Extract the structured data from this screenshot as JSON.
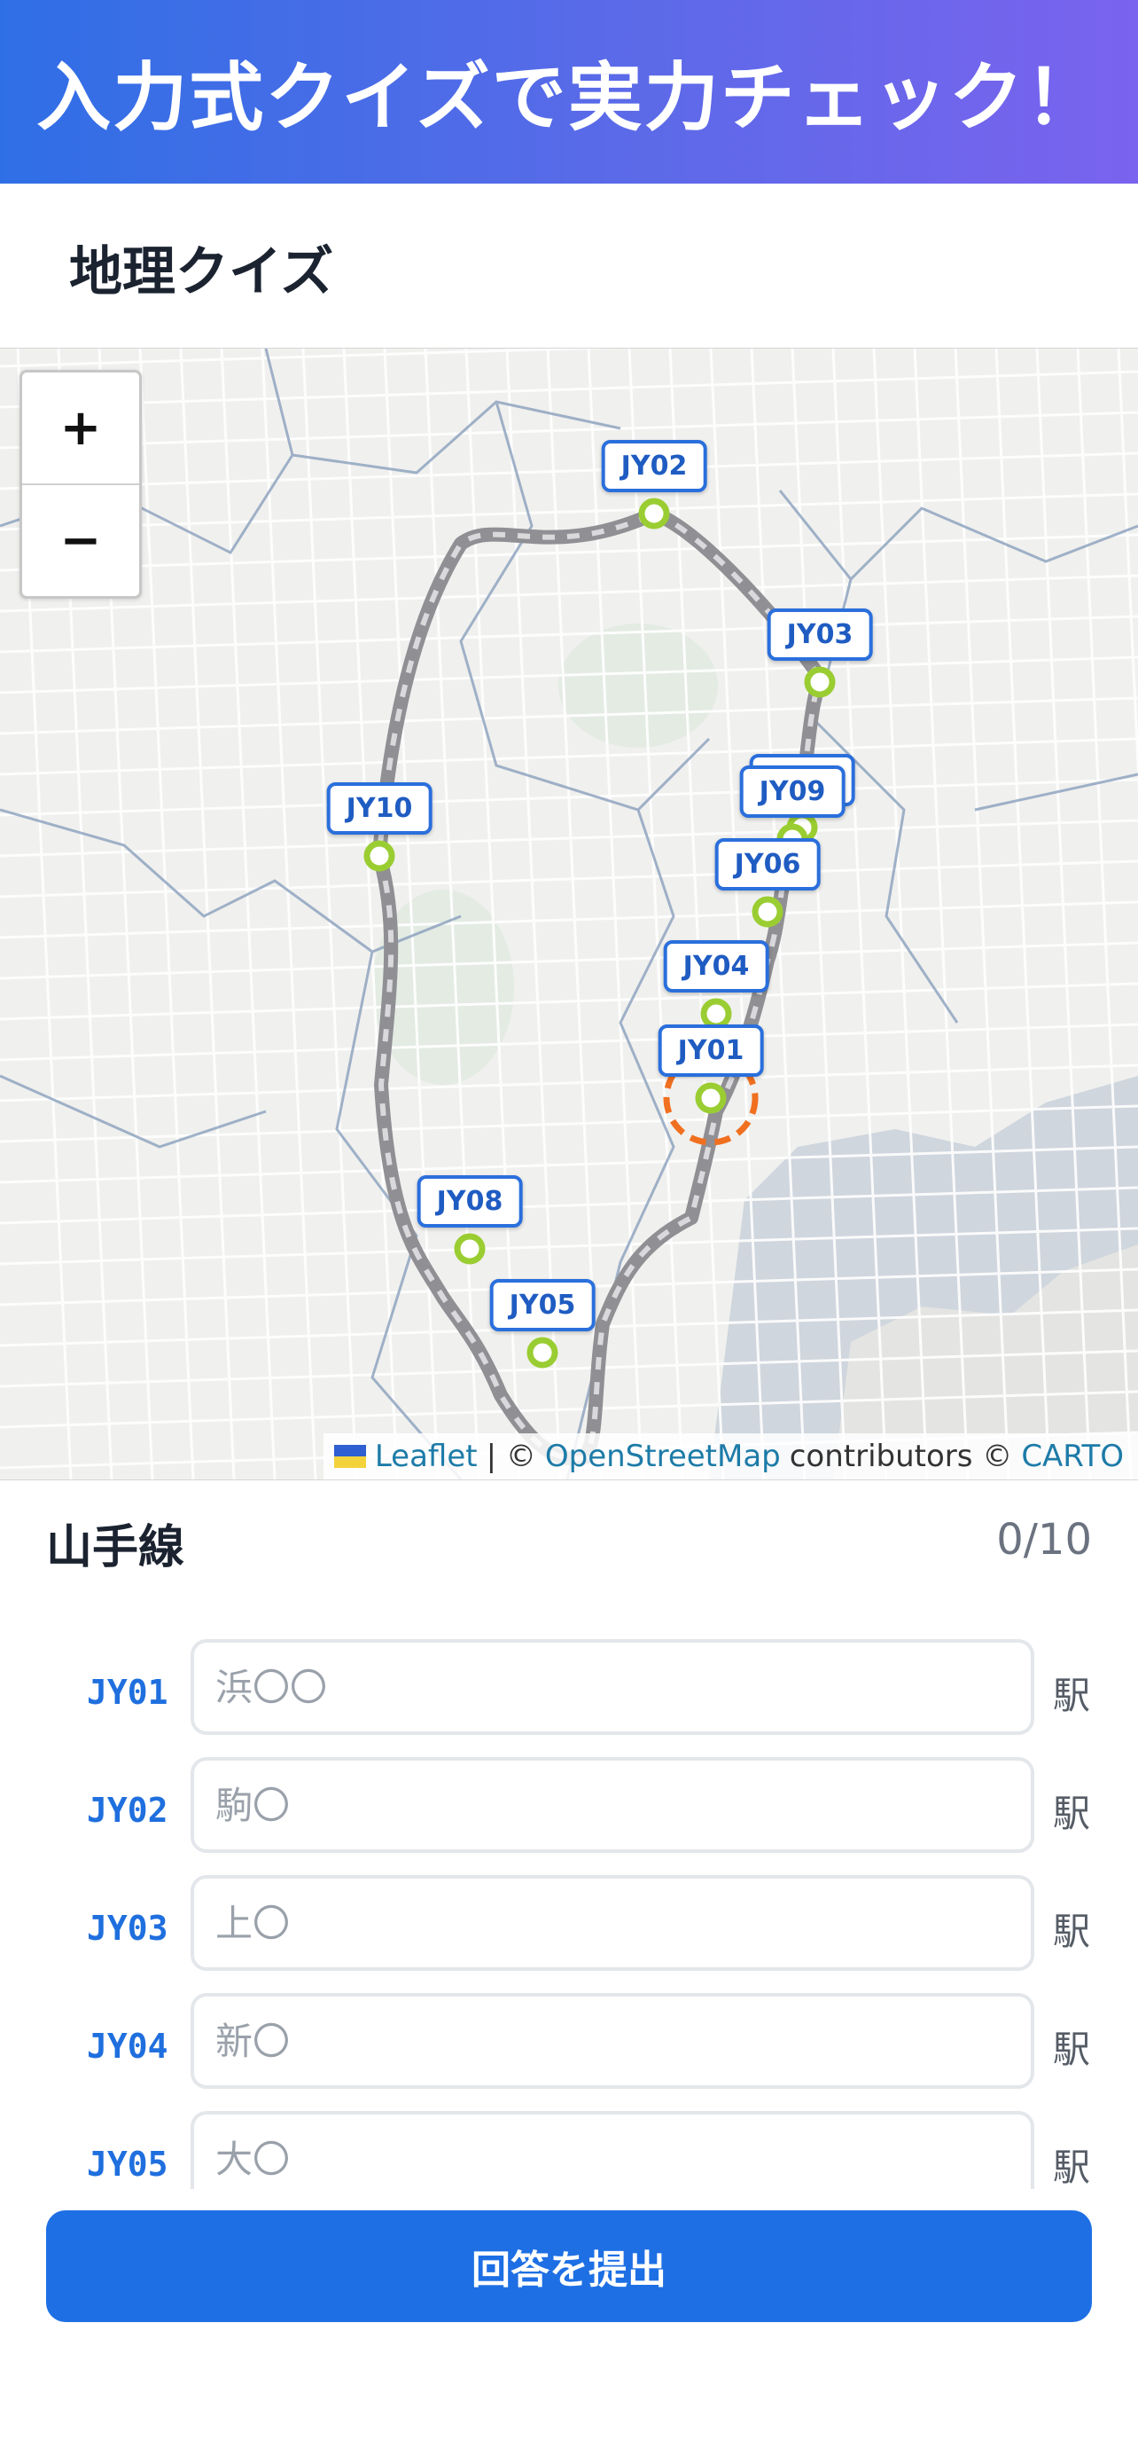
{
  "banner": {
    "title": "入力式クイズで実力チェック！"
  },
  "quiz": {
    "title": "地理クイズ"
  },
  "map": {
    "zoom_in": "+",
    "zoom_out": "−",
    "stations": [
      {
        "code": "JY01",
        "highlighted": true
      },
      {
        "code": "JY02"
      },
      {
        "code": "JY03"
      },
      {
        "code": "JY04"
      },
      {
        "code": "JY05"
      },
      {
        "code": "JY06"
      },
      {
        "code": "JY07"
      },
      {
        "code": "JY08"
      },
      {
        "code": "JY09"
      },
      {
        "code": "JY10"
      }
    ],
    "attribution": {
      "leaflet": "Leaflet",
      "sep1": "| ©",
      "osm": "OpenStreetMap",
      "contrib": "contributors ©",
      "carto": "CARTO"
    }
  },
  "line": {
    "name": "山手線",
    "progress": "0/10"
  },
  "answers": [
    {
      "code": "JY01",
      "value": "",
      "placeholder": "浜〇〇",
      "suffix": "駅"
    },
    {
      "code": "JY02",
      "value": "",
      "placeholder": "駒〇",
      "suffix": "駅"
    },
    {
      "code": "JY03",
      "value": "",
      "placeholder": "上〇",
      "suffix": "駅"
    },
    {
      "code": "JY04",
      "value": "",
      "placeholder": "新〇",
      "suffix": "駅"
    },
    {
      "code": "JY05",
      "value": "",
      "placeholder": "大〇",
      "suffix": "駅"
    }
  ],
  "submit": {
    "label": "回答を提出"
  },
  "colors": {
    "accent": "#1e6fe4",
    "station_marker": "#9acd32",
    "highlight_ring": "#f07020",
    "route": "#8f8f94"
  }
}
